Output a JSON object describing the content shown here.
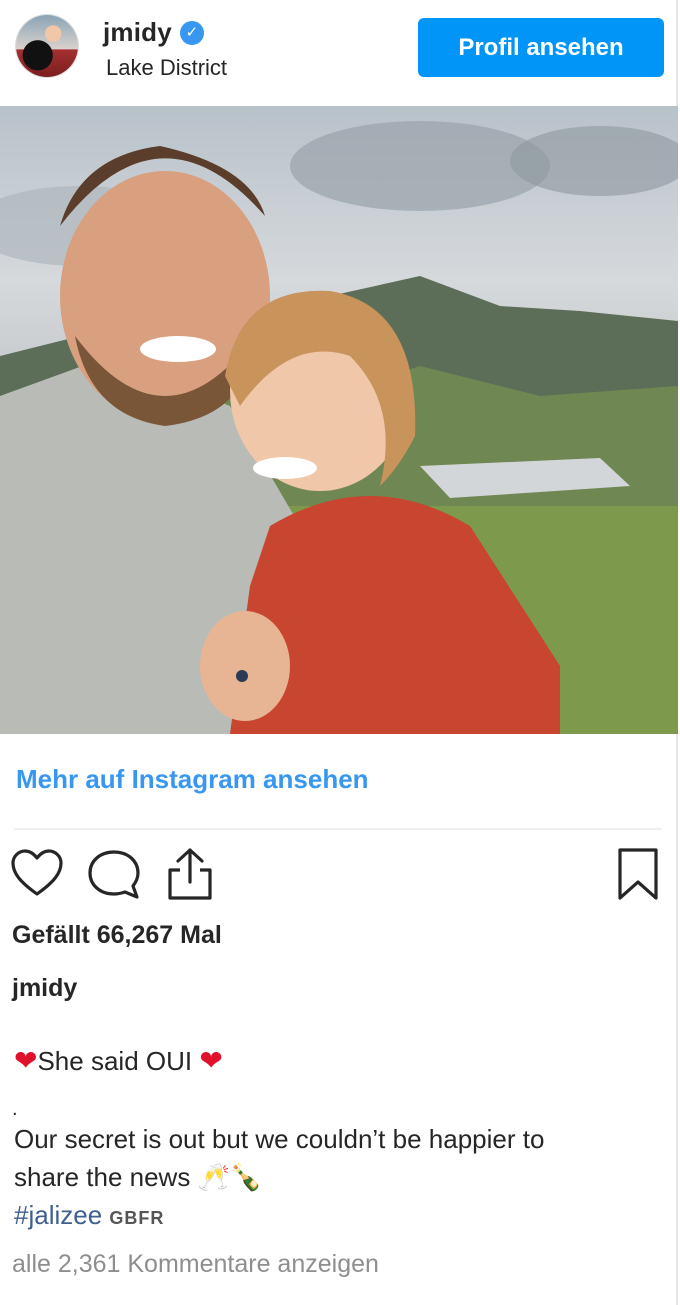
{
  "header": {
    "username": "jmidy",
    "verified_glyph": "✓",
    "location": "Lake District",
    "profile_button_label": "Profil ansehen"
  },
  "post": {
    "more_link": "Mehr auf Instagram ansehen",
    "likes_text": "Gefällt 66,267 Mal",
    "author": "jmidy",
    "caption": {
      "heart_left": "❤",
      "line1_text": "She said OUI",
      "heart_right": "❤",
      "dot": ".",
      "line2": "Our secret is out but we couldn’t be happier to",
      "line3_text": "share the news",
      "line3_emoji": "🥂🍾",
      "hashtag": "#jalizee",
      "tag": "GBFR"
    },
    "comments_link": "alle 2,361 Kommentare anzeigen"
  },
  "icons": {
    "like": "heart-outline-icon",
    "comment": "speech-bubble-icon",
    "share": "share-arrow-icon",
    "save": "bookmark-icon"
  },
  "colors": {
    "accent": "#0095f6",
    "link": "#3897f0",
    "hashtag": "#3f5f8f",
    "muted": "#8e8e8e",
    "heart": "#e0112b"
  }
}
